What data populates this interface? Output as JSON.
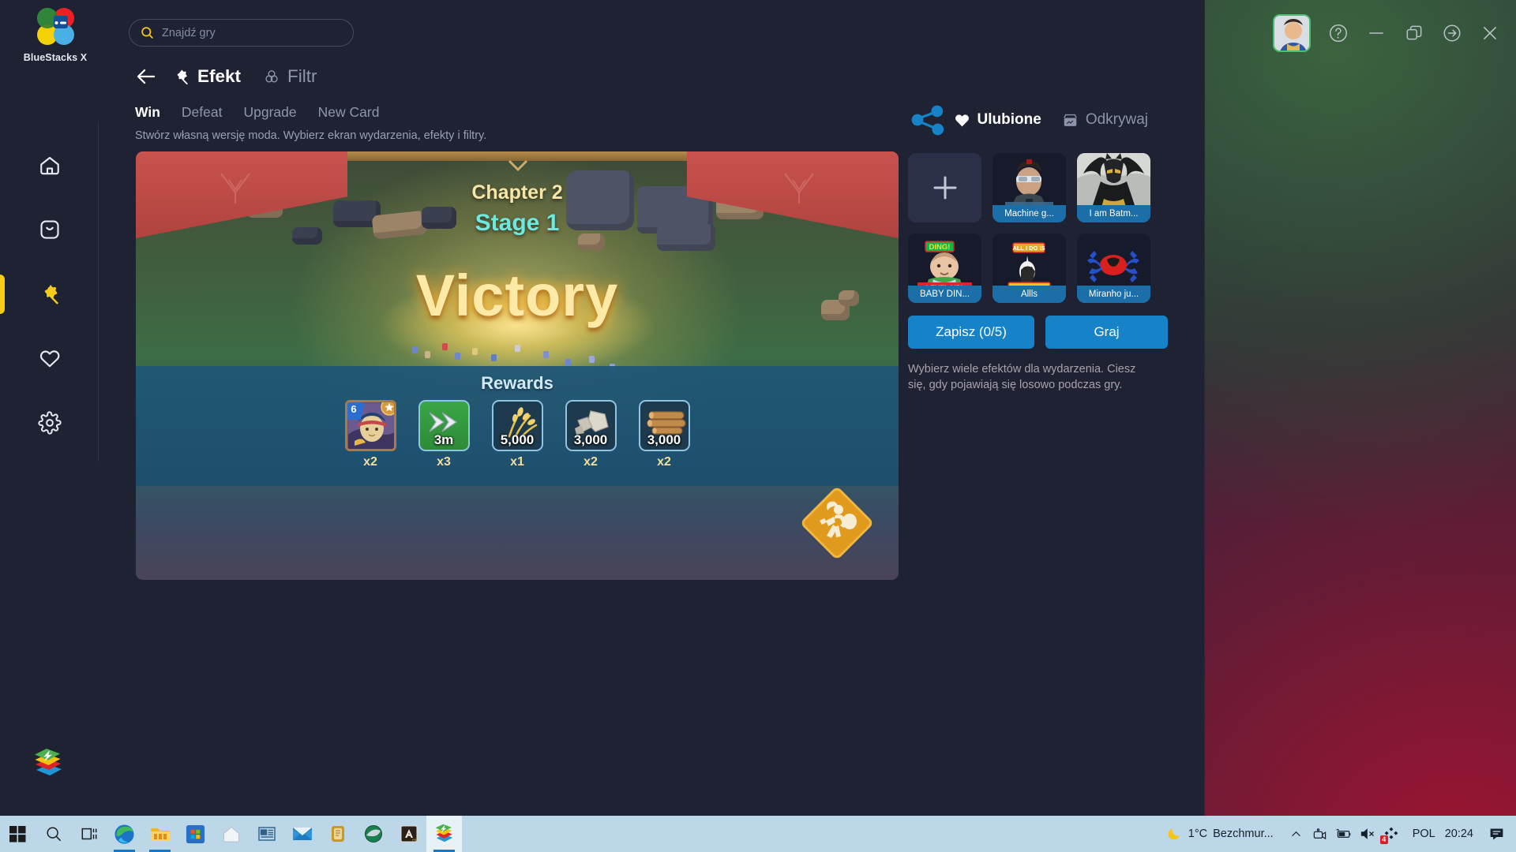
{
  "app": {
    "brand": "BlueStacks X",
    "search": {
      "placeholder": "Znajdź gry",
      "value": ""
    }
  },
  "window_controls": {
    "help": "help-circle",
    "minimize": "minimize",
    "restore": "restore",
    "forward": "arrow-right-circle",
    "close": "close"
  },
  "sidebar": {
    "items": [
      {
        "name": "home",
        "icon": "home-icon",
        "active": false
      },
      {
        "name": "app-center",
        "icon": "app-bag-icon",
        "active": false
      },
      {
        "name": "effects",
        "icon": "magic-wand-icon",
        "active": true
      },
      {
        "name": "favorites",
        "icon": "heart-icon",
        "active": false
      },
      {
        "name": "settings",
        "icon": "gear-icon",
        "active": false
      }
    ],
    "bottom_logo": "bluestacks-logo"
  },
  "toolbar": {
    "back": "back-arrow",
    "effect_label": "Efekt",
    "filter_label": "Filtr"
  },
  "tabs": {
    "items": [
      "Win",
      "Defeat",
      "Upgrade",
      "New Card"
    ],
    "selected": "Win"
  },
  "subtitle": "Stwórz własną wersję moda. Wybierz ekran wydarzenia, efekty i filtry.",
  "preview": {
    "chapter": "Chapter 2",
    "stage": "Stage 1",
    "result": "Victory",
    "rewards_title": "Rewards",
    "rewards": [
      {
        "label": "",
        "multiplier": "x2",
        "kind": "hero-card",
        "level": "6"
      },
      {
        "label": "3m",
        "multiplier": "x3",
        "kind": "speedup"
      },
      {
        "label": "5,000",
        "multiplier": "x1",
        "kind": "food"
      },
      {
        "label": "3,000",
        "multiplier": "x2",
        "kind": "stone"
      },
      {
        "label": "3,000",
        "multiplier": "x2",
        "kind": "wood"
      }
    ],
    "badge": "quest-runner-icon"
  },
  "right_panel": {
    "share_icon": "share-icon",
    "tabs": [
      {
        "label": "Ulubione",
        "icon": "heart-filled-icon",
        "selected": true
      },
      {
        "label": "Odkrywaj",
        "icon": "store-icon",
        "selected": false
      }
    ],
    "grid": [
      {
        "type": "add",
        "caption": "",
        "icon": "plus-icon"
      },
      {
        "type": "thumb",
        "caption": "Machine g...",
        "art": "robot-man"
      },
      {
        "type": "thumb",
        "caption": "I am Batm...",
        "art": "batman"
      },
      {
        "type": "thumb",
        "caption": "BABY DIN...",
        "art": "baby-ding-level-up"
      },
      {
        "type": "thumb",
        "caption": "Allls",
        "art": "all-i-do-is-win"
      },
      {
        "type": "thumb",
        "caption": "Miranho ju...",
        "art": "red-spider"
      }
    ],
    "save_button": "Zapisz (0/5)",
    "play_button": "Graj",
    "hint": "Wybierz wiele efektów dla wydarzenia. Ciesz się, gdy pojawiają się losowo podczas gry."
  },
  "taskbar": {
    "left_icons": [
      "windows-start-icon",
      "search-icon",
      "task-view-icon",
      "edge-icon",
      "file-explorer-icon",
      "microsoft-store-icon",
      "home-icon",
      "news-icon",
      "mail-icon",
      "notes-icon",
      "maps-icon",
      "a-pro-icon",
      "bluestacks-icon"
    ],
    "weather_temp": "1°C",
    "weather_desc": "Bezchmur...",
    "locale": "POL",
    "clock": "20:24",
    "tray_badge": "4"
  },
  "colors": {
    "accent_blue": "#1683c9",
    "accent_yellow": "#f5cc18",
    "panel_bg": "#1e2233",
    "caption_blue": "#1b6ea8"
  }
}
